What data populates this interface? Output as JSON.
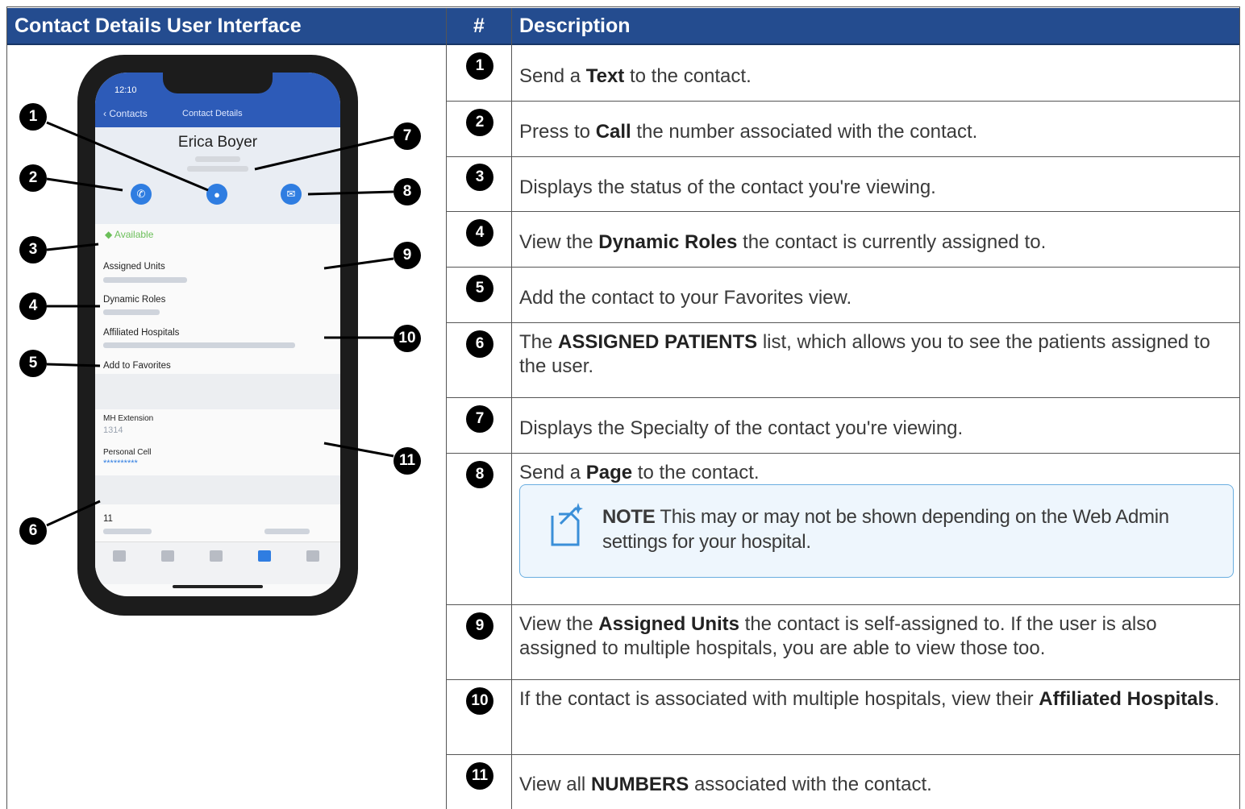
{
  "header": {
    "left_title": "Contact Details User Interface",
    "num_title": "#",
    "desc_title": "Description"
  },
  "phone": {
    "time": "12:10",
    "back": "Contacts",
    "screen_title": "Contact Details",
    "contact_name": "Erica Boyer",
    "status": "Available",
    "assigned_units": "Assigned Units",
    "dynamic_roles": "Dynamic Roles",
    "affiliated_hospitals": "Affiliated Hospitals",
    "add_favorites": "Add to Favorites",
    "mh_extension": "MH Extension",
    "mh_extension_value": "1314",
    "personal_cell": "Personal Cell",
    "personal_cell_value": "**********",
    "patient_num": "11"
  },
  "callouts": [
    "1",
    "2",
    "3",
    "4",
    "5",
    "6",
    "7",
    "8",
    "9",
    "10",
    "11"
  ],
  "rows": [
    {
      "num": "1",
      "parts": [
        {
          "t": "Send a "
        },
        {
          "t": "Text",
          "b": true
        },
        {
          "t": " to the contact."
        }
      ]
    },
    {
      "num": "2",
      "parts": [
        {
          "t": "Press to "
        },
        {
          "t": "Call",
          "b": true
        },
        {
          "t": " the number associated with the contact."
        }
      ]
    },
    {
      "num": "3",
      "parts": [
        {
          "t": "Displays the status of the contact you're viewing."
        }
      ]
    },
    {
      "num": "4",
      "parts": [
        {
          "t": "View the "
        },
        {
          "t": "Dynamic Roles",
          "b": true
        },
        {
          "t": " the contact is currently assigned to."
        }
      ]
    },
    {
      "num": "5",
      "parts": [
        {
          "t": "Add the contact to your Favorites view."
        }
      ]
    },
    {
      "num": "6",
      "parts": [
        {
          "t": "The "
        },
        {
          "t": "ASSIGNED PATIENTS",
          "b": true
        },
        {
          "t": " list, which allows you to see the patients assigned to the user."
        }
      ]
    },
    {
      "num": "7",
      "parts": [
        {
          "t": "Displays the Specialty of the contact you're viewing."
        }
      ]
    },
    {
      "num": "8",
      "parts": [
        {
          "t": "Send a "
        },
        {
          "t": "Page",
          "b": true
        },
        {
          "t": " to the contact."
        }
      ]
    },
    {
      "num": "9",
      "parts": [
        {
          "t": "View the "
        },
        {
          "t": "Assigned Units",
          "b": true
        },
        {
          "t": " the contact is self-assigned to. If the user is also assigned to multiple hospitals, you are able to view those too."
        }
      ]
    },
    {
      "num": "10",
      "parts": [
        {
          "t": "If the contact is associated with multiple hospitals, view their "
        },
        {
          "t": "Affiliated Hospitals",
          "b": true
        },
        {
          "t": "."
        }
      ]
    },
    {
      "num": "11",
      "parts": [
        {
          "t": "View all "
        },
        {
          "t": "NUMBERS",
          "b": true
        },
        {
          "t": " associated with the contact."
        }
      ]
    }
  ],
  "note": {
    "label": "NOTE",
    "text": " This may or may not be shown depending on the Web Admin settings for your hospital."
  }
}
